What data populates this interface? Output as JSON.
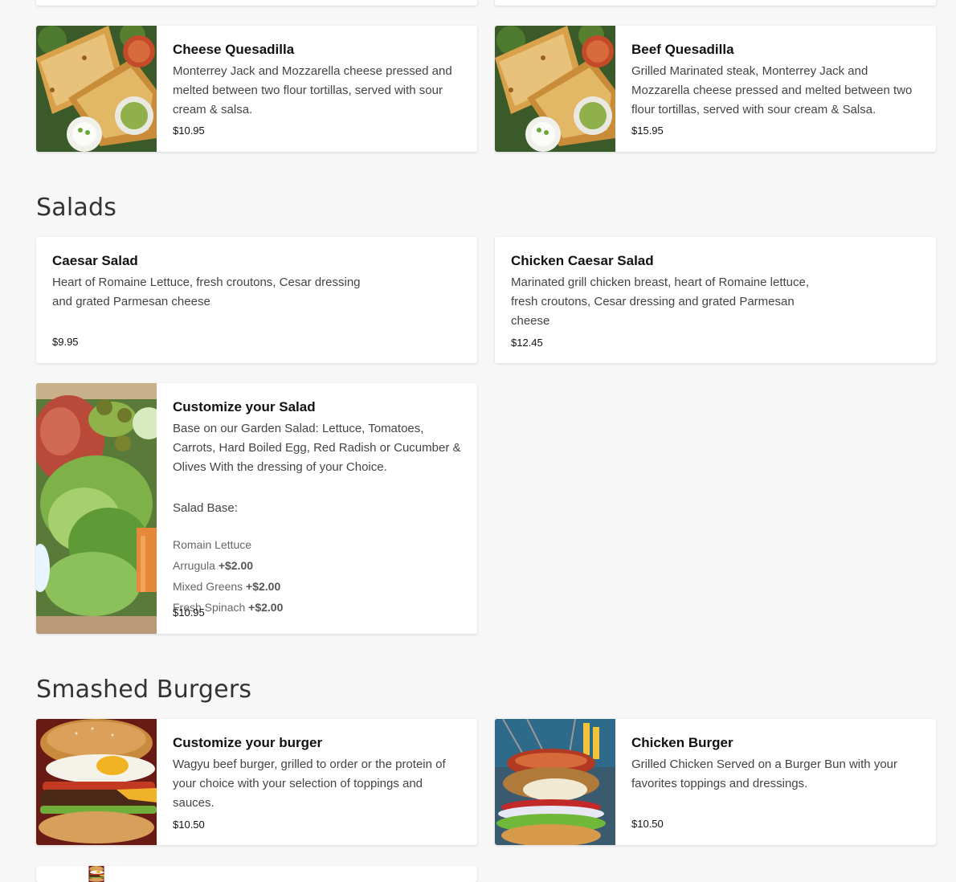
{
  "sections": {
    "salads": "Salads",
    "burgers": "Smashed Burgers"
  },
  "items": {
    "cheese_quesadilla": {
      "name": "Cheese Quesadilla",
      "description": "Monterrey Jack and Mozzarella cheese pressed and melted between two flour tortillas, served with sour cream & salsa.",
      "price": "$10.95",
      "image_icon": "quesadilla-image"
    },
    "beef_quesadilla": {
      "name": "Beef Quesadilla",
      "description": "Grilled Marinated steak, Monterrey Jack and Mozzarella cheese pressed and melted between two flour tortillas, served with sour cream & Salsa.",
      "price": "$15.95",
      "image_icon": "quesadilla-image"
    },
    "caesar_salad": {
      "name": "Caesar Salad",
      "description": "Heart of Romaine Lettuce, fresh croutons, Cesar dressing and grated Parmesan cheese",
      "price": "$9.95"
    },
    "chicken_caesar_salad": {
      "name": "Chicken Caesar Salad",
      "description": "Marinated grill chicken breast, heart of Romaine lettuce, fresh croutons, Cesar dressing and grated Parmesan cheese",
      "price": "$12.45"
    },
    "custom_salad": {
      "name": "Customize your Salad",
      "description": "Base on our Garden Salad: Lettuce, Tomatoes, Carrots, Hard Boiled Egg, Red Radish or Cucumber & Olives With the dressing of your Choice.",
      "options_label": "Salad Base:",
      "options": [
        {
          "name": "Romain Lettuce",
          "extra": ""
        },
        {
          "name": "Arrugula",
          "extra": "+$2.00"
        },
        {
          "name": "Mixed Greens",
          "extra": "+$2.00"
        },
        {
          "name": "Fresh Spinach",
          "extra": "+$2.00"
        }
      ],
      "price": "$10.95",
      "image_icon": "salad-image"
    },
    "custom_burger": {
      "name": "Customize your burger",
      "description": "Wagyu beef burger, grilled to order or the protein of your choice with your selection of toppings and sauces.",
      "price": "$10.50",
      "image_icon": "burger-image"
    },
    "chicken_burger": {
      "name": "Chicken Burger",
      "description": "Grilled Chicken Served on a Burger Bun with your favorites toppings and dressings.",
      "price": "$10.50",
      "image_icon": "chicken-burger-image"
    }
  },
  "colors": {
    "page_bg": "#f7f7f7",
    "card_bg": "#ffffff",
    "title": "#111111",
    "text": "#444444"
  }
}
